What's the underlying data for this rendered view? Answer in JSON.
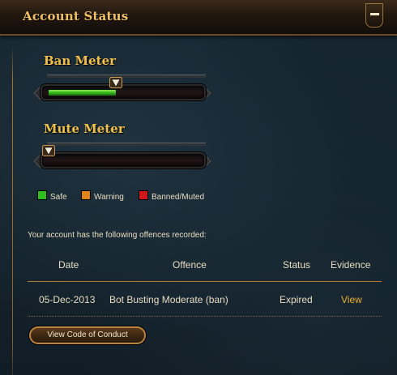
{
  "header": {
    "title": "Account Status",
    "collapse_icon": "minus-icon"
  },
  "meters": [
    {
      "label": "Ban Meter",
      "level": 0.45,
      "marker_icon": "triangle-down-icon"
    },
    {
      "label": "Mute Meter",
      "level": 0.0,
      "marker_icon": "triangle-down-icon"
    }
  ],
  "legend": [
    {
      "label": "Safe",
      "color": "#2fbf1f"
    },
    {
      "label": "Warning",
      "color": "#e0841a"
    },
    {
      "label": "Banned/Muted",
      "color": "#d0181c"
    }
  ],
  "offences": {
    "intro": "Your account has the following offences recorded:",
    "columns": [
      "Date",
      "Offence",
      "Status",
      "Evidence"
    ],
    "rows": [
      {
        "date": "05-Dec-2013",
        "offence": "Bot Busting Moderate (ban)",
        "status": "Expired",
        "evidence": "View"
      }
    ]
  },
  "conduct_button": "View Code of Conduct",
  "colors": {
    "accent": "#f2c04a",
    "link": "#f0b030",
    "border": "#b07b34"
  }
}
